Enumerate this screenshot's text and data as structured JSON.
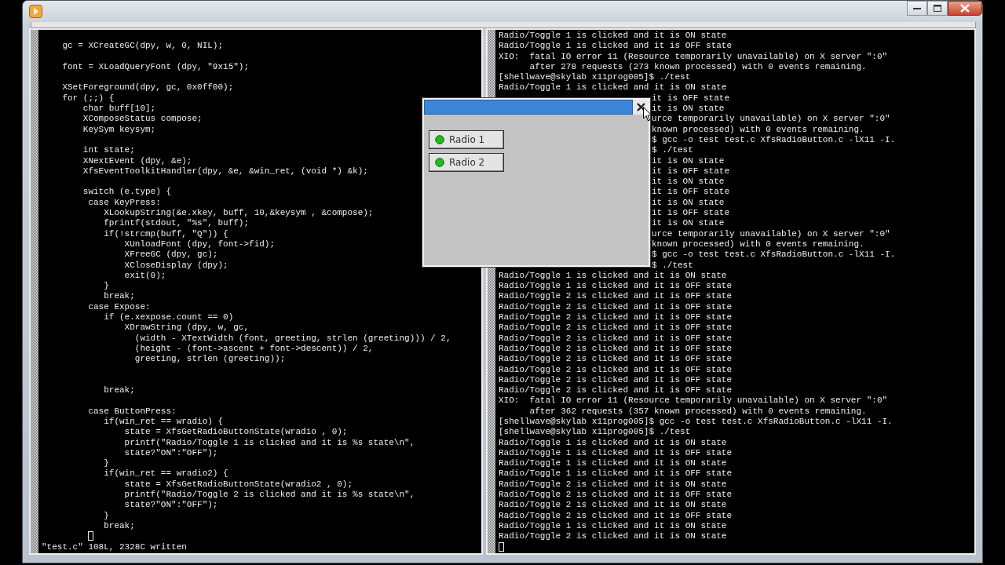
{
  "editor": {
    "lines": [
      {
        "kind": "blank"
      },
      {
        "kind": "code",
        "text": "    gc = XCreateGC(dpy, w, 0, NIL);"
      },
      {
        "kind": "blank"
      },
      {
        "kind": "code",
        "text": "    font = XLoadQueryFont (dpy, \"9x15\");"
      },
      {
        "kind": "blank"
      },
      {
        "kind": "code",
        "text": "    XSetForeground(dpy, gc, 0x0ff00);"
      },
      {
        "kind": "code",
        "text": "    for (;;) {"
      },
      {
        "kind": "code",
        "text": "        char buff[10];"
      },
      {
        "kind": "code",
        "text": "        XComposeStatus compose;"
      },
      {
        "kind": "code",
        "text": "        KeySym keysym;"
      },
      {
        "kind": "blank"
      },
      {
        "kind": "code",
        "text": "        int state;"
      },
      {
        "kind": "code",
        "text": "        XNextEvent (dpy, &e);"
      },
      {
        "kind": "code",
        "text": "        XfsEventToolkitHandler(dpy, &e, &win_ret, (void *) &k);"
      },
      {
        "kind": "blank"
      },
      {
        "kind": "code",
        "text": "        switch (e.type) {"
      },
      {
        "kind": "code",
        "text": "         case KeyPress:"
      },
      {
        "kind": "code",
        "text": "            XLookupString(&e.xkey, buff, 10,&keysym , &compose);"
      },
      {
        "kind": "code",
        "text": "            fprintf(stdout, \"%s\", buff);"
      },
      {
        "kind": "code",
        "text": "            if(!strcmp(buff, \"Q\")) {"
      },
      {
        "kind": "code",
        "text": "                XUnloadFont (dpy, font->fid);"
      },
      {
        "kind": "code",
        "text": "                XFreeGC (dpy, gc);"
      },
      {
        "kind": "code",
        "text": "                XCloseDisplay (dpy);"
      },
      {
        "kind": "code",
        "text": "                exit(0);"
      },
      {
        "kind": "code",
        "text": "            }"
      },
      {
        "kind": "code",
        "text": "            break;"
      },
      {
        "kind": "code",
        "text": "         case Expose:"
      },
      {
        "kind": "code",
        "text": "            if (e.xexpose.count == 0)"
      },
      {
        "kind": "code",
        "text": "                XDrawString (dpy, w, gc,"
      },
      {
        "kind": "code",
        "text": "                  (width - XTextWidth (font, greeting, strlen (greeting))) / 2,"
      },
      {
        "kind": "code",
        "text": "                  (height - (font->ascent + font->descent)) / 2,"
      },
      {
        "kind": "code",
        "text": "                  greeting, strlen (greeting));"
      },
      {
        "kind": "blank"
      },
      {
        "kind": "blank"
      },
      {
        "kind": "code",
        "text": "            break;"
      },
      {
        "kind": "blank"
      },
      {
        "kind": "code",
        "text": "         case ButtonPress:"
      },
      {
        "kind": "code",
        "text": "            if(win_ret == wradio) {"
      },
      {
        "kind": "code",
        "text": "                state = XfsGetRadioButtonState(wradio , 0);"
      },
      {
        "kind": "code",
        "text": "                printf(\"Radio/Toggle 1 is clicked and it is %s state\\n\","
      },
      {
        "kind": "code",
        "text": "                state?\"ON\":\"OFF\");"
      },
      {
        "kind": "code",
        "text": "            }"
      },
      {
        "kind": "code",
        "text": "            if(win_ret == wradio2) {"
      },
      {
        "kind": "code",
        "text": "                state = XfsGetRadioButtonState(wradio2 , 0);"
      },
      {
        "kind": "code",
        "text": "                printf(\"Radio/Toggle 2 is clicked and it is %s state\\n\","
      },
      {
        "kind": "code",
        "text": "                state?\"ON\":\"OFF\");"
      },
      {
        "kind": "code",
        "text": "            }"
      },
      {
        "kind": "code",
        "text": "            break;"
      },
      {
        "kind": "cursor"
      }
    ],
    "status": "\"test.c\" 108L, 2328C written"
  },
  "terminal": {
    "lines": [
      {
        "kind": "output",
        "text": "Radio/Toggle 1 is clicked and it is ON state"
      },
      {
        "kind": "output",
        "text": "Radio/Toggle 1 is clicked and it is OFF state"
      },
      {
        "kind": "output",
        "text": "XIO:  fatal IO error 11 (Resource temporarily unavailable) on X server \":0\""
      },
      {
        "kind": "output",
        "text": "      after 278 requests (273 known processed) with 0 events remaining."
      },
      {
        "kind": "output",
        "text": "[shellwave@skylab x11prog005]$ ./test"
      },
      {
        "kind": "output",
        "text": "Radio/Toggle 1 is clicked and it is ON state"
      },
      {
        "kind": "covered",
        "text": "it is OFF state"
      },
      {
        "kind": "covered",
        "text": "it is ON state"
      },
      {
        "kind": "covered",
        "text": "urce temporarily unavailable) on X server \":0\""
      },
      {
        "kind": "covered",
        "text": "known processed) with 0 events remaining."
      },
      {
        "kind": "covered",
        "text": "$ gcc -o test test.c XfsRadioButton.c -lX11 -I."
      },
      {
        "kind": "covered",
        "text": "$ ./test"
      },
      {
        "kind": "covered",
        "text": "it is ON state"
      },
      {
        "kind": "covered",
        "text": "it is OFF state"
      },
      {
        "kind": "covered",
        "text": "it is ON state"
      },
      {
        "kind": "covered",
        "text": "it is OFF state"
      },
      {
        "kind": "covered",
        "text": "it is ON state"
      },
      {
        "kind": "covered",
        "text": "it is OFF state"
      },
      {
        "kind": "covered",
        "text": "it is ON state"
      },
      {
        "kind": "covered",
        "text": "urce temporarily unavailable) on X server \":0\""
      },
      {
        "kind": "covered",
        "text": "known processed) with 0 events remaining."
      },
      {
        "kind": "covered",
        "text": "$ gcc -o test test.c XfsRadioButton.c -lX11 -I."
      },
      {
        "kind": "covered",
        "text": "$ ./test"
      },
      {
        "kind": "output",
        "text": "Radio/Toggle 1 is clicked and it is ON state"
      },
      {
        "kind": "output",
        "text": "Radio/Toggle 1 is clicked and it is OFF state"
      },
      {
        "kind": "output",
        "text": "Radio/Toggle 2 is clicked and it is OFF state"
      },
      {
        "kind": "output",
        "text": "Radio/Toggle 2 is clicked and it is OFF state"
      },
      {
        "kind": "output",
        "text": "Radio/Toggle 2 is clicked and it is OFF state"
      },
      {
        "kind": "output",
        "text": "Radio/Toggle 2 is clicked and it is OFF state"
      },
      {
        "kind": "output",
        "text": "Radio/Toggle 2 is clicked and it is OFF state"
      },
      {
        "kind": "output",
        "text": "Radio/Toggle 2 is clicked and it is OFF state"
      },
      {
        "kind": "output",
        "text": "Radio/Toggle 2 is clicked and it is OFF state"
      },
      {
        "kind": "output",
        "text": "Radio/Toggle 2 is clicked and it is OFF state"
      },
      {
        "kind": "output",
        "text": "Radio/Toggle 2 is clicked and it is OFF state"
      },
      {
        "kind": "output",
        "text": "Radio/Toggle 2 is clicked and it is OFF state"
      },
      {
        "kind": "output",
        "text": "XIO:  fatal IO error 11 (Resource temporarily unavailable) on X server \":0\""
      },
      {
        "kind": "output",
        "text": "      after 362 requests (357 known processed) with 0 events remaining."
      },
      {
        "kind": "output",
        "text": "[shellwave@skylab x11prog005]$ gcc -o test test.c XfsRadioButton.c -lX11 -I."
      },
      {
        "kind": "output",
        "text": "[shellwave@skylab x11prog005]$ ./test"
      },
      {
        "kind": "output",
        "text": "Radio/Toggle 1 is clicked and it is ON state"
      },
      {
        "kind": "output",
        "text": "Radio/Toggle 1 is clicked and it is OFF state"
      },
      {
        "kind": "output",
        "text": "Radio/Toggle 1 is clicked and it is ON state"
      },
      {
        "kind": "output",
        "text": "Radio/Toggle 1 is clicked and it is OFF state"
      },
      {
        "kind": "output",
        "text": "Radio/Toggle 2 is clicked and it is ON state"
      },
      {
        "kind": "output",
        "text": "Radio/Toggle 2 is clicked and it is OFF state"
      },
      {
        "kind": "output",
        "text": "Radio/Toggle 2 is clicked and it is ON state"
      },
      {
        "kind": "output",
        "text": "Radio/Toggle 2 is clicked and it is OFF state"
      },
      {
        "kind": "output",
        "text": "Radio/Toggle 1 is clicked and it is ON state"
      },
      {
        "kind": "output",
        "text": "Radio/Toggle 2 is clicked and it is ON state"
      },
      {
        "kind": "cursor"
      }
    ]
  },
  "dialog": {
    "radios": [
      {
        "label": "Radio 1",
        "on": true
      },
      {
        "label": "Radio 2",
        "on": true
      }
    ]
  }
}
